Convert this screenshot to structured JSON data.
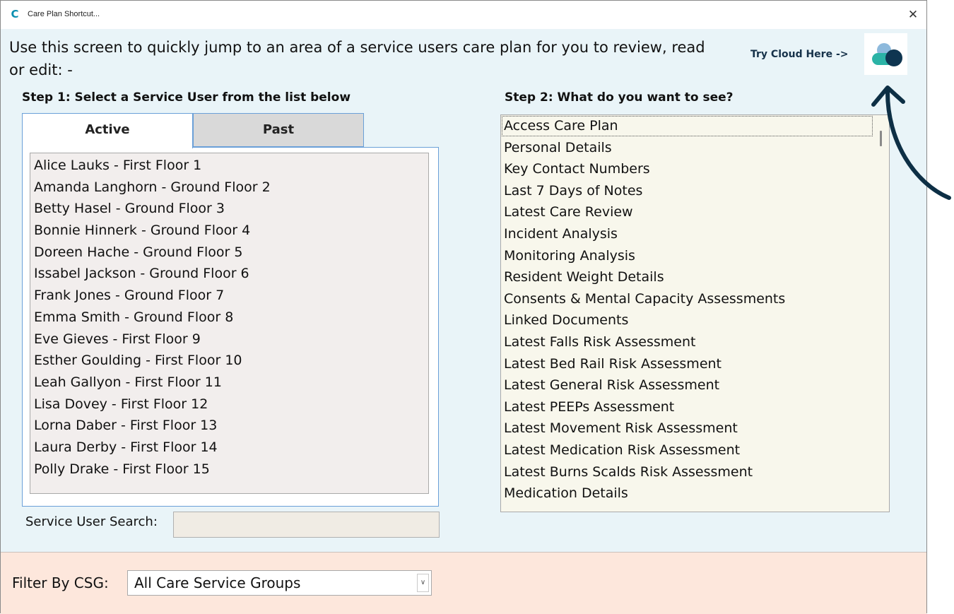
{
  "window": {
    "title": "Care Plan Shortcut..."
  },
  "intro": "Use this screen to quickly jump to an area of a service users care plan for you to review, read or edit: -",
  "cloud": {
    "link_text": "Try Cloud Here ->"
  },
  "step1": {
    "title": "Step 1: Select a Service User from the list below",
    "tabs": [
      {
        "label": "Active"
      },
      {
        "label": "Past"
      }
    ],
    "users": [
      "Alice Lauks - First Floor 1",
      "Amanda Langhorn - Ground Floor 2",
      "Betty Hasel - Ground Floor 3",
      "Bonnie Hinnerk - Ground Floor 4",
      "Doreen Hache - Ground Floor 5",
      "Issabel Jackson - Ground Floor 6",
      "Frank Jones - Ground Floor 7",
      "Emma Smith - Ground Floor 8",
      "Eve Gieves - First Floor 9",
      "Esther Goulding - First Floor 10",
      "Leah Gallyon - First Floor 11",
      "Lisa Dovey - First Floor 12",
      "Lorna Daber - First Floor 13",
      "Laura Derby - First Floor 14",
      "Polly Drake - First Floor 15"
    ],
    "search": {
      "label": "Service User Search:",
      "value": ""
    }
  },
  "step2": {
    "title": "Step 2: What do you want to see?",
    "options": [
      "Access Care Plan",
      "Personal Details",
      "Key Contact Numbers",
      "Last 7 Days of Notes",
      "Latest Care Review",
      "Incident Analysis",
      "Monitoring Analysis",
      "Resident Weight Details",
      "Consents & Mental Capacity Assessments",
      "Linked Documents",
      "Latest Falls Risk Assessment",
      "Latest Bed Rail Risk Assessment",
      "Latest General Risk Assessment",
      "Latest PEEPs Assessment",
      "Latest Movement Risk Assessment",
      "Latest Medication Risk Assessment",
      "Latest Burns Scalds Risk Assessment",
      "Medication Details"
    ]
  },
  "footer": {
    "filter_label": "Filter By CSG:",
    "filter_value": "All Care Service Groups"
  },
  "colors": {
    "window_bg": "#e9f4f8",
    "footer_bg": "#fde7dc",
    "tab_border": "#6aa0d8",
    "annotation_arrow": "#0d2f45",
    "cloud_teal": "#2bb3a6",
    "cloud_navy": "#0e3550"
  },
  "icons": {
    "app": "care-c-logo-icon",
    "close": "close-icon",
    "cloud": "cloud-logo-icon",
    "dropdown": "chevron-down-icon"
  }
}
